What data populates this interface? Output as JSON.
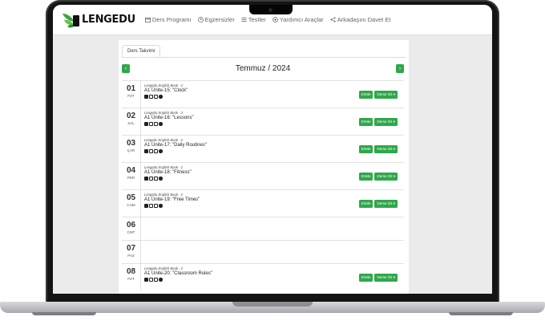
{
  "brand": {
    "name": "LENGEDU"
  },
  "nav": {
    "items": [
      {
        "label": "Ders Programı",
        "icon": "calendar-icon"
      },
      {
        "label": "Egzersizler",
        "icon": "clock-icon"
      },
      {
        "label": "Testler",
        "icon": "list-icon"
      },
      {
        "label": "Yardımcı Araçlar",
        "icon": "plus-circle-icon"
      },
      {
        "label": "Arkadaşını Davet Et",
        "icon": "share-icon"
      }
    ]
  },
  "calendar": {
    "tab_label": "Ders Takvimi",
    "month_label": "Temmuz / 2024",
    "prev_label": "‹",
    "next_label": "›",
    "btn_primary": "Ertele",
    "btn_secondary": "Derse Git ▾",
    "days": [
      {
        "num": "01",
        "name": "PZT",
        "book": "Lengedu English Book - 2",
        "unit": "A1 Ünite-15: \"Clock\""
      },
      {
        "num": "02",
        "name": "SAL",
        "book": "Lengedu English Book - 2",
        "unit": "A1 Ünite-16: \"Lessons\""
      },
      {
        "num": "03",
        "name": "ÇAR",
        "book": "Lengedu English Book - 2",
        "unit": "A1 Ünite-17: \"Daily Routines\""
      },
      {
        "num": "04",
        "name": "PER",
        "book": "Lengedu English Book - 2",
        "unit": "A1 Ünite-18: \"Fitness\""
      },
      {
        "num": "05",
        "name": "CUM",
        "book": "Lengedu English Book - 2",
        "unit": "A1 Ünite-19: \"Free Times\""
      },
      {
        "num": "06",
        "name": "CMT",
        "book": "",
        "unit": ""
      },
      {
        "num": "07",
        "name": "PAZ",
        "book": "",
        "unit": ""
      },
      {
        "num": "08",
        "name": "PZT",
        "book": "Lengedu English Book - 2",
        "unit": "A1 Ünite-20: \"Classroom Rules\""
      }
    ]
  }
}
